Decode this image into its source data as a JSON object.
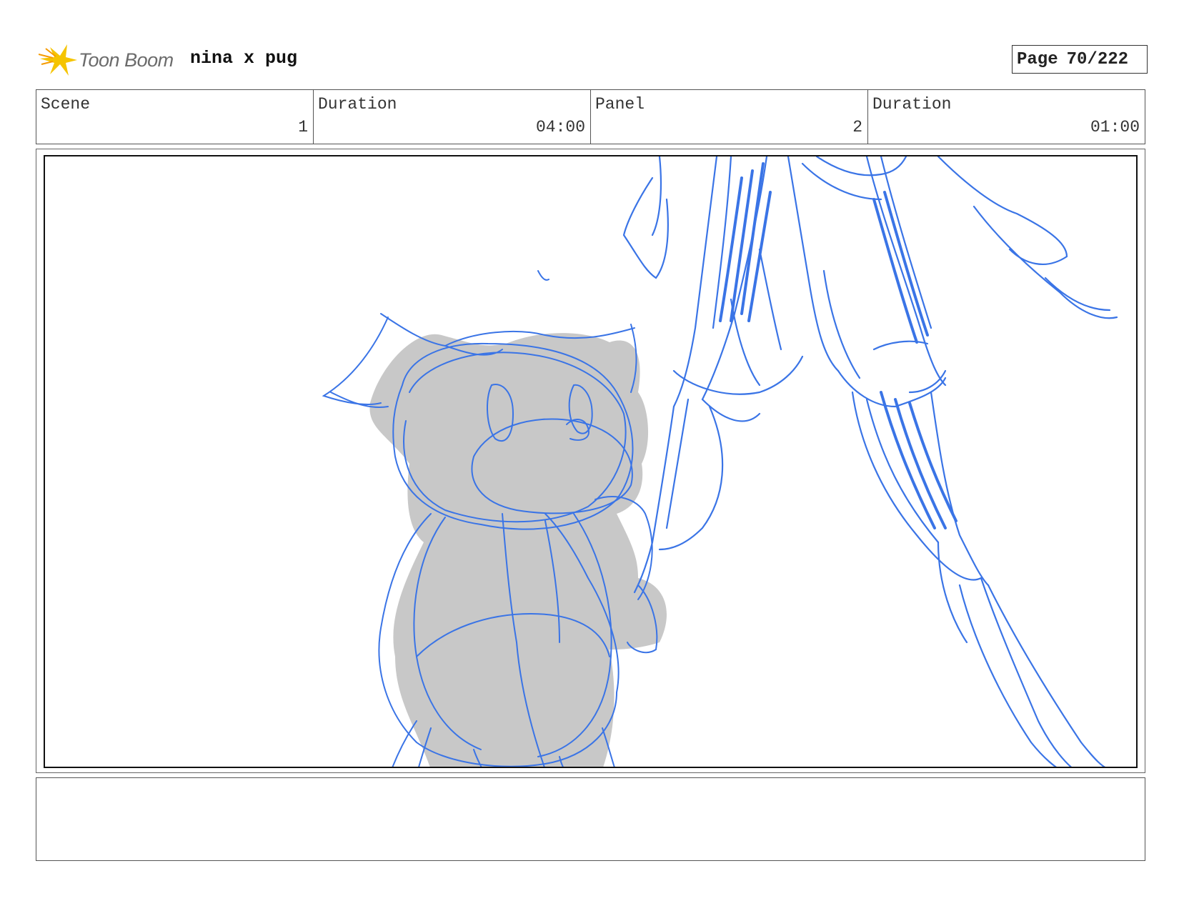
{
  "header": {
    "logo_text": "Toon Boom",
    "project_title": "nina x pug",
    "page_label": "Page",
    "page_value": "70/222"
  },
  "info": {
    "scene_label": "Scene",
    "scene_value": "1",
    "scene_duration_label": "Duration",
    "scene_duration_value": "04:00",
    "panel_label": "Panel",
    "panel_value": "2",
    "panel_duration_label": "Duration",
    "panel_duration_value": "01:00"
  },
  "notes": {
    "text": ""
  },
  "colors": {
    "sketch_blue": "#3a74e6",
    "fill_gray": "#c8c8c8",
    "logo_yellow": "#f5c400"
  },
  "icons": {
    "logo": "toon-boom-star-icon"
  }
}
